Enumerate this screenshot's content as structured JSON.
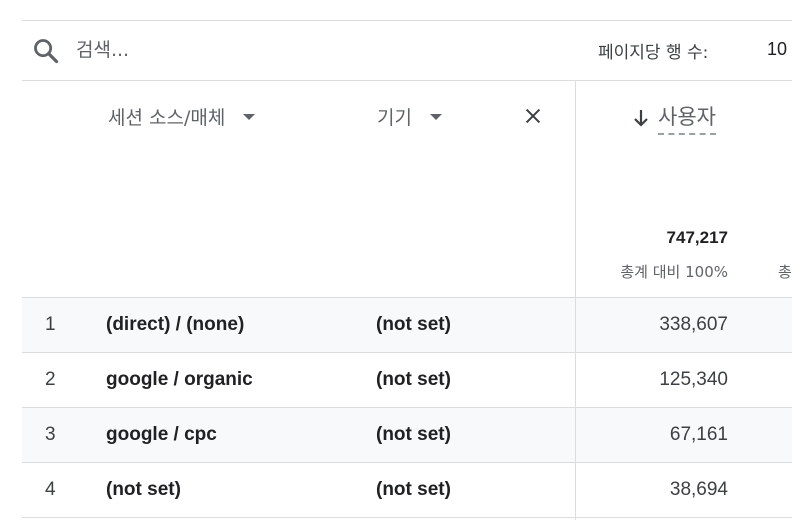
{
  "search": {
    "placeholder": "검색..."
  },
  "pagination": {
    "rows_per_page_label": "페이지당 행 수:",
    "rows_per_page_value": "10"
  },
  "columns": {
    "dim1": {
      "label": "세션 소스/매체"
    },
    "dim2": {
      "label": "기기"
    },
    "metric": {
      "label": "사용자",
      "sort": "descending"
    }
  },
  "totals": {
    "users": "747,217",
    "pct_label": "총계 대비 100%",
    "next_col_pct_partial": "총"
  },
  "rows": [
    {
      "index": "1",
      "source": "(direct) / (none)",
      "device": "(not set)",
      "users": "338,607"
    },
    {
      "index": "2",
      "source": "google / organic",
      "device": "(not set)",
      "users": "125,340"
    },
    {
      "index": "3",
      "source": "google / cpc",
      "device": "(not set)",
      "users": "67,161"
    },
    {
      "index": "4",
      "source": "(not set)",
      "device": "(not set)",
      "users": "38,694"
    }
  ],
  "icons": {
    "search": "search-icon",
    "sort": "arrow-down-icon",
    "remove": "close-icon",
    "dropdown": "caret-down-icon"
  },
  "colors": {
    "text": "#202124",
    "muted": "#5f6368",
    "divider": "#dadce0",
    "row_shade": "#f8f9fa"
  }
}
